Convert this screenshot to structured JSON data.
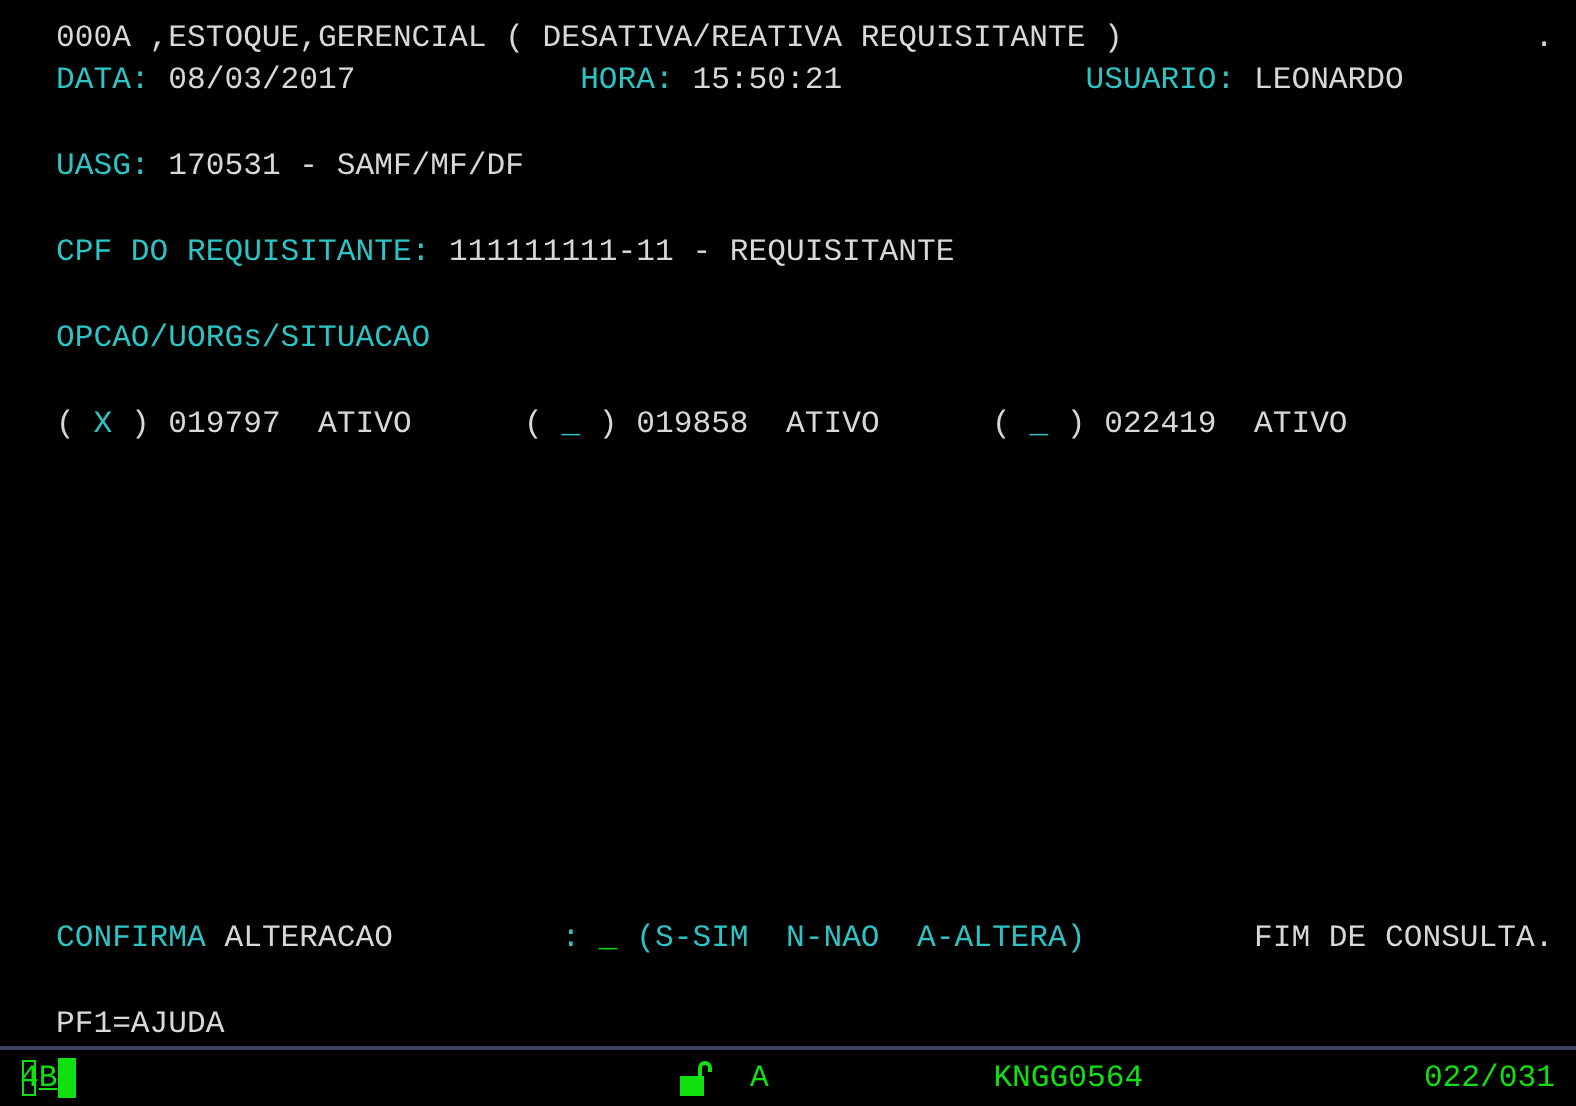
{
  "title": "000A ,ESTOQUE,GERENCIAL ( DESATIVA/REATIVA REQUISITANTE )",
  "corner_mark": ".",
  "header": {
    "date_label": "DATA:",
    "date": "08/03/2017",
    "time_label": "HORA:",
    "time": "15:50:21",
    "user_label": "USUARIO:",
    "user": "LEONARDO"
  },
  "uasg": {
    "label": "UASG:",
    "value": "170531 - SAMF/MF/DF"
  },
  "requester": {
    "label": "CPF DO REQUISITANTE:",
    "value": "111111111-11 - REQUISITANTE"
  },
  "options_label": "OPCAO/UORGs/SITUACAO",
  "options": [
    {
      "open": "(",
      "value": "X",
      "close": ")",
      "uorg": "019797",
      "status": "ATIVO"
    },
    {
      "open": "(",
      "value": "_",
      "close": ")",
      "uorg": "019858",
      "status": "ATIVO"
    },
    {
      "open": "(",
      "value": "_",
      "close": ")",
      "uorg": "022419",
      "status": "ATIVO"
    }
  ],
  "confirm": {
    "label": "CONFIRMA",
    "label_2": "ALTERACAO",
    "colon": ":",
    "value": "_",
    "hint": "(S-SIM  N-NAO  A-ALTERA)"
  },
  "message": "FIM DE CONSULTA.",
  "help": "PF1=AJUDA",
  "status_bar": {
    "session": "4",
    "mode": "B",
    "keyboard": "A",
    "terminal": "KNGG0564",
    "cursor_position": "022/031"
  }
}
